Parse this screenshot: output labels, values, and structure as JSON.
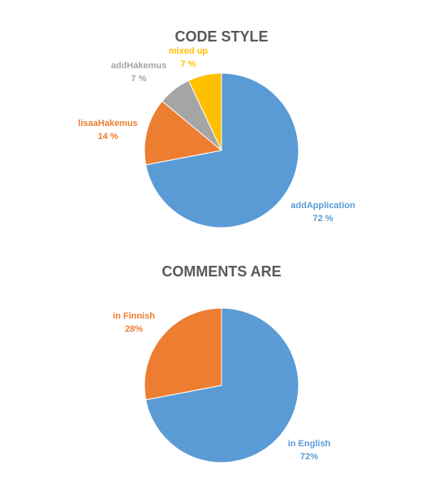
{
  "chart_data": [
    {
      "type": "pie",
      "title": "CODE STYLE",
      "slices": [
        {
          "label": "addApplication",
          "value": 72,
          "display": "72 %",
          "color": "#5B9BD5"
        },
        {
          "label": "lisaaHakemus",
          "value": 14,
          "display": "14 %",
          "color": "#ED7D31"
        },
        {
          "label": "addHakemus",
          "value": 7,
          "display": "7 %",
          "color": "#A5A5A5"
        },
        {
          "label": "mixed up",
          "value": 7,
          "display": "7 %",
          "color": "#FFC000"
        }
      ]
    },
    {
      "type": "pie",
      "title": "COMMENTS ARE",
      "slices": [
        {
          "label": "in English",
          "value": 72,
          "display": "72%",
          "color": "#5B9BD5"
        },
        {
          "label": "in Finnish",
          "value": 28,
          "display": "28%",
          "color": "#ED7D31"
        }
      ]
    }
  ]
}
